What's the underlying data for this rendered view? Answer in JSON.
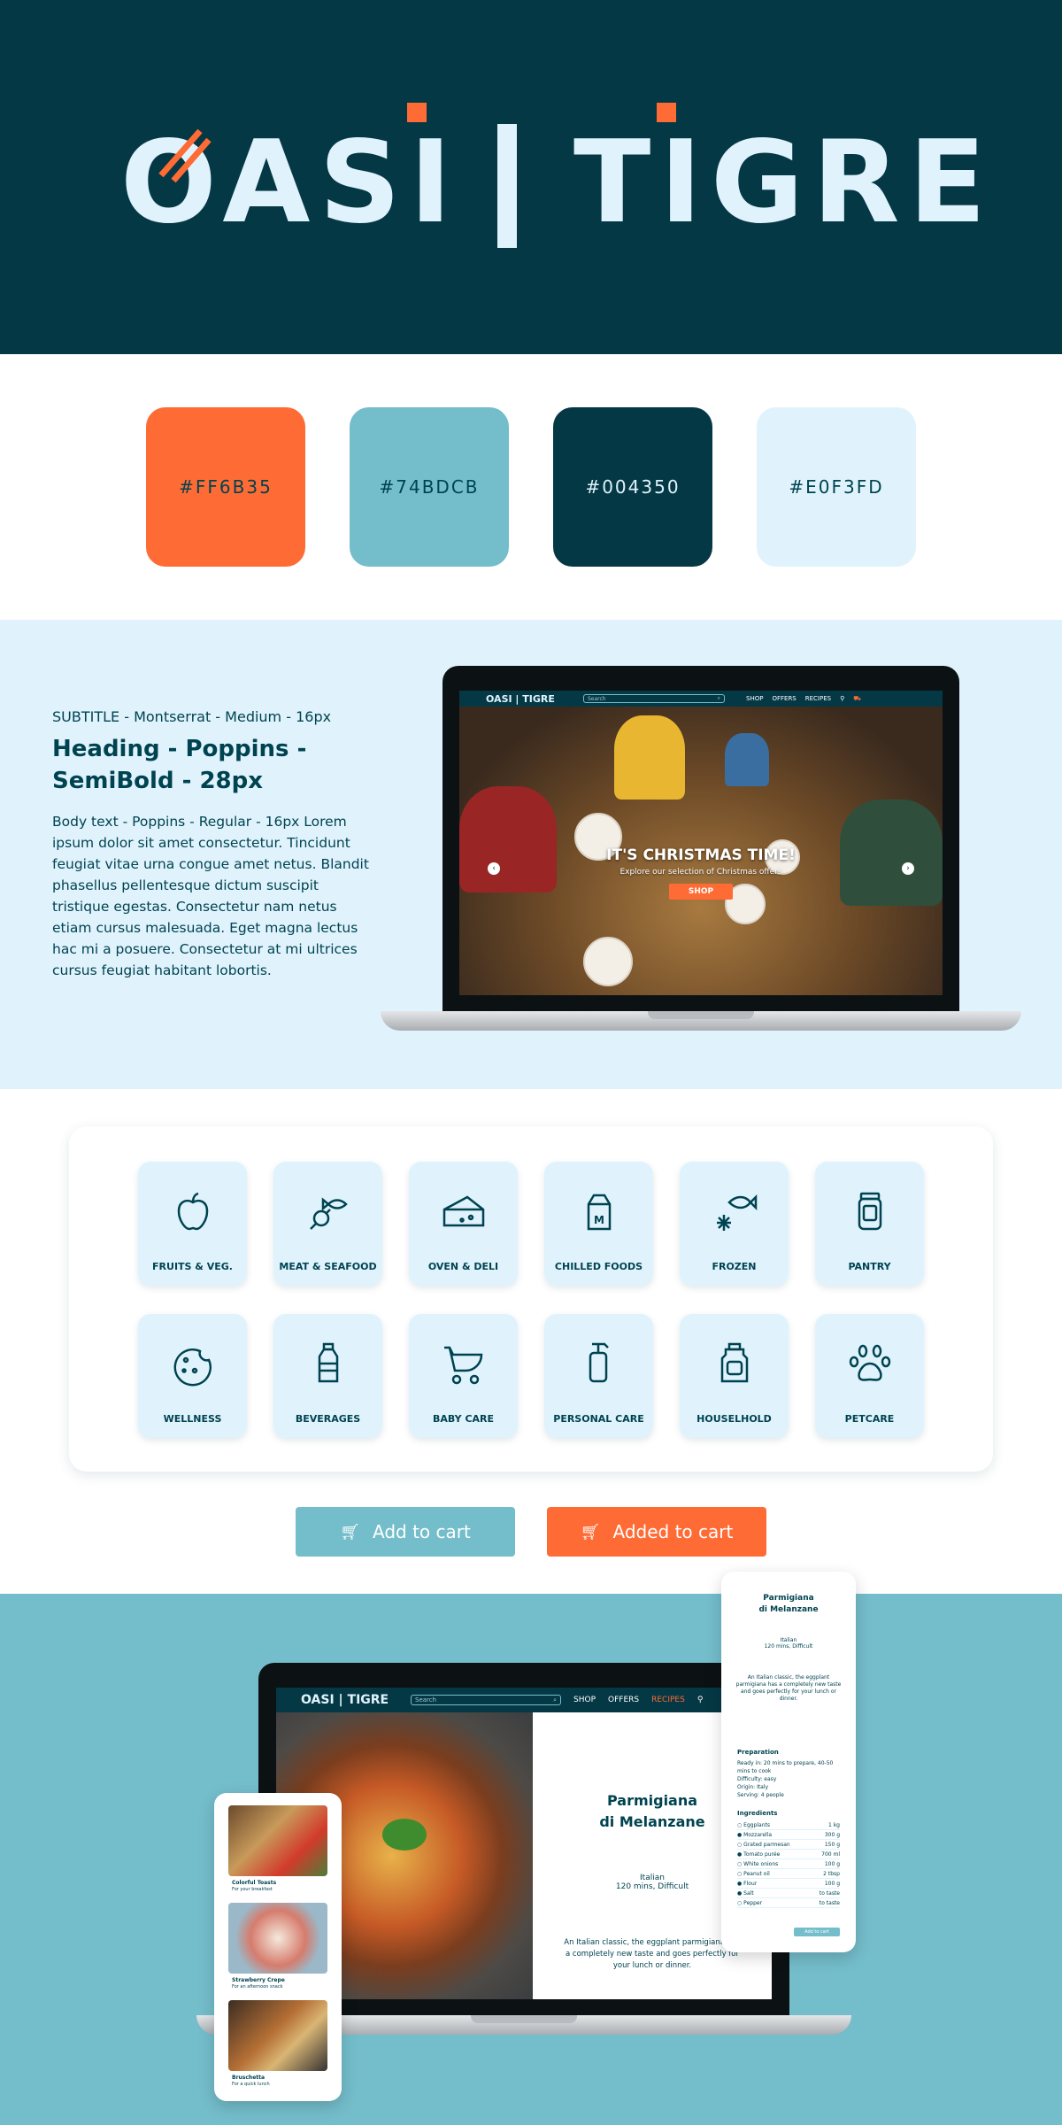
{
  "brand": {
    "logo_text": "OASI | TIGRE",
    "logo_left": "OASI",
    "logo_right": "TIGRE",
    "nav_logo": "OASI | TIGRE"
  },
  "palette": [
    {
      "hex": "#FF6B35",
      "color": "#FF6B35",
      "text_color": "#004350"
    },
    {
      "hex": "#74BDCB",
      "color": "#74BDCB",
      "text_color": "#004350"
    },
    {
      "hex": "#004350",
      "color": "#053845",
      "text_color": "#E0F3FD"
    },
    {
      "hex": "#E0F3FD",
      "color": "#E0F3FD",
      "text_color": "#004350"
    }
  ],
  "typography": {
    "subtitle": "SUBTITLE  - Montserrat - Medium - 16px",
    "heading": "Heading - Poppins - SemiBold - 28px",
    "body": "Body text - Poppins - Regular - 16px Lorem ipsum dolor sit amet consectetur. Tincidunt feugiat vitae urna congue amet netus. Blandit phasellus pellentesque dictum suscipit tristique egestas. Consectetur nam netus etiam cursus malesuada. Eget magna lectus hac mi a posuere. Consectetur at mi ultrices cursus feugiat habitant lobortis."
  },
  "home_screen": {
    "search_placeholder": "Search",
    "nav": [
      "SHOP",
      "OFFERS",
      "RECIPES"
    ],
    "banner_title": "IT'S CHRISTMAS TIME!",
    "banner_subtitle": "Explore our selection of Christmas offers",
    "banner_button": "SHOP"
  },
  "categories": [
    {
      "label": "FRUITS & VEG.",
      "icon": "apple-icon"
    },
    {
      "label": "MEAT & SEAFOOD",
      "icon": "meat-fish-icon"
    },
    {
      "label": "OVEN & DELI",
      "icon": "cheese-icon"
    },
    {
      "label": "CHILLED FOODS",
      "icon": "milk-carton-icon"
    },
    {
      "label": "FROZEN",
      "icon": "frozen-fish-icon"
    },
    {
      "label": "PANTRY",
      "icon": "jar-icon"
    },
    {
      "label": "WELLNESS",
      "icon": "cookie-icon"
    },
    {
      "label": "BEVERAGES",
      "icon": "bottle-icon"
    },
    {
      "label": "BABY CARE",
      "icon": "stroller-icon"
    },
    {
      "label": "PERSONAL CARE",
      "icon": "pump-bottle-icon"
    },
    {
      "label": "HOUSELHOLD",
      "icon": "detergent-icon"
    },
    {
      "label": "PETCARE",
      "icon": "paw-icon"
    }
  ],
  "buttons": {
    "add_to_cart": "Add to cart",
    "added_to_cart": "Added to cart"
  },
  "recipe_screen": {
    "search_placeholder": "Search",
    "nav": [
      "SHOP",
      "OFFERS",
      "RECIPES"
    ],
    "title_line1": "Parmigiana",
    "title_line2": "di Melanzane",
    "cuisine": "Italian",
    "meta": "120 mins, Difficult",
    "description": "An Italian classic, the eggplant parmigiana has a completely new taste and goes perfectly for your lunch or dinner."
  },
  "recipe_phone": {
    "title_line1": "Parmigiana",
    "title_line2": "di Melanzane",
    "cuisine": "Italian",
    "meta": "120 mins, Difficult",
    "description": "An Italian classic, the eggplant parmigiana has a completely new taste and goes perfectly for your lunch or dinner.",
    "preparation_heading": "Preparation",
    "preparation": [
      "Ready in: 20 mins to prepare, 40-50 mins to cook",
      "Difficulty: easy",
      "Origin: Italy",
      "Serving: 4 people"
    ],
    "ingredients_heading": "Ingredients",
    "ingredients": [
      {
        "name": "Eggplants",
        "qty": "1 kg",
        "checked": false
      },
      {
        "name": "Mozzarella",
        "qty": "300 g",
        "checked": true
      },
      {
        "name": "Grated parmesan",
        "qty": "150 g",
        "checked": false
      },
      {
        "name": "Tomato purée",
        "qty": "700 ml",
        "checked": true
      },
      {
        "name": "White onions",
        "qty": "100 g",
        "checked": false
      },
      {
        "name": "Peanut oil",
        "qty": "2 tbsp",
        "checked": false
      },
      {
        "name": "Flour",
        "qty": "100 g",
        "checked": true
      },
      {
        "name": "Salt",
        "qty": "to taste",
        "checked": true
      },
      {
        "name": "Pepper",
        "qty": "to taste",
        "checked": false
      }
    ],
    "add_button": "Add to cart"
  },
  "list_phone": {
    "items": [
      {
        "title": "Colorful Toasts",
        "subtitle": "For your breakfast"
      },
      {
        "title": "Strawberry Crepe",
        "subtitle": "For an afternoon snack"
      },
      {
        "title": "Bruschetta",
        "subtitle": "For a quick lunch"
      }
    ]
  }
}
